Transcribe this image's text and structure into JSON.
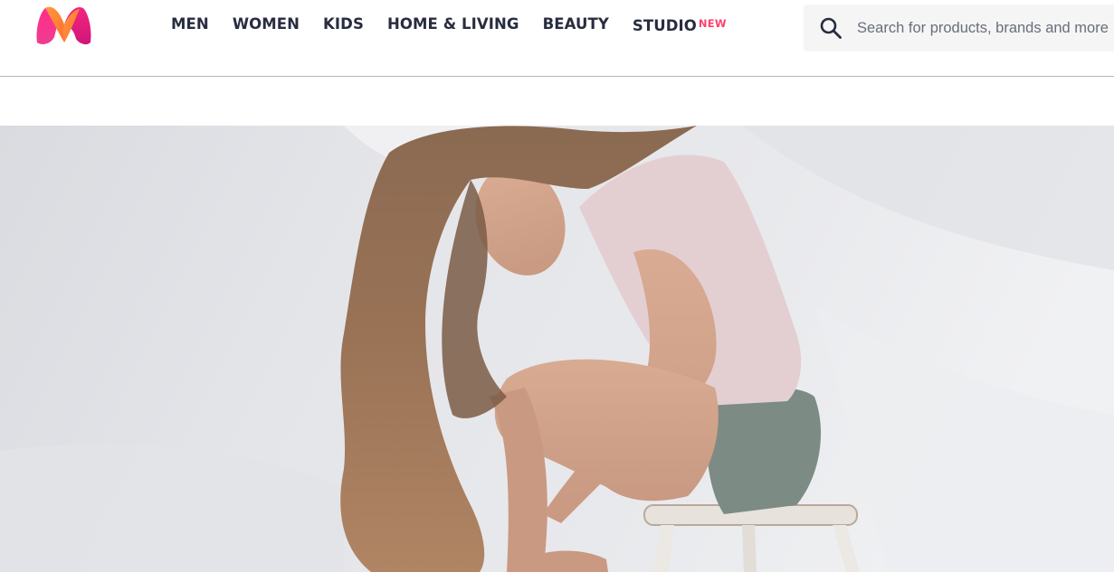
{
  "brand": {
    "logo_icon": "myntra-logo-icon",
    "colors": {
      "pink": "#ff3f6c",
      "magenta": "#e8258f",
      "orange": "#ff9b3e",
      "nav_text": "#282c3f"
    }
  },
  "nav": {
    "items": [
      {
        "label": "MEN"
      },
      {
        "label": "WOMEN"
      },
      {
        "label": "KIDS"
      },
      {
        "label": "HOME & LIVING"
      },
      {
        "label": "BEAUTY"
      },
      {
        "label": "STUDIO",
        "badge": "NEW"
      }
    ]
  },
  "search": {
    "icon": "search-icon",
    "placeholder": "Search for products, brands and more",
    "value": ""
  },
  "hero": {
    "image": "hero-banner-image",
    "description_icon": "model-photo"
  }
}
